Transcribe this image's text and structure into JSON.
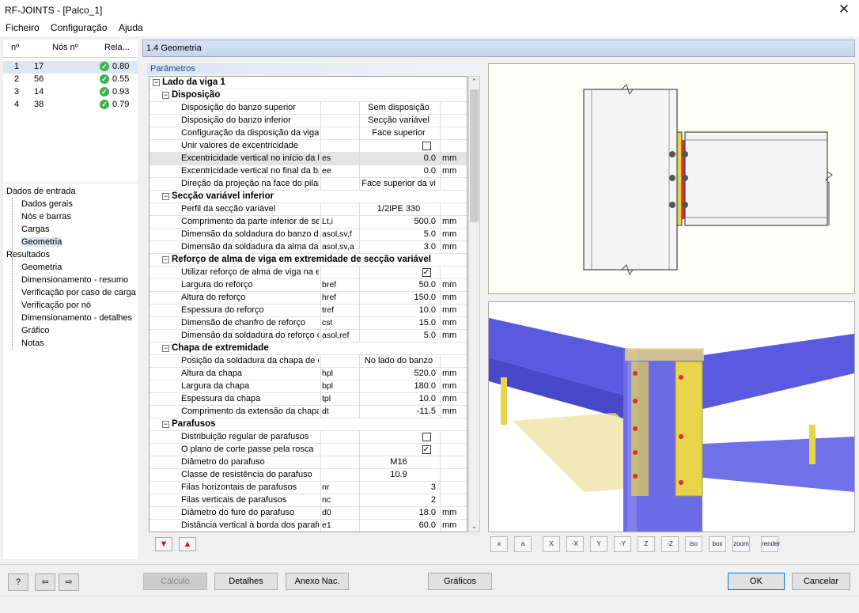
{
  "window": {
    "title": "RF-JOINTS - [Palco_1]",
    "close": "✕"
  },
  "menu": [
    "Ficheiro",
    "Configuração",
    "Ajuda"
  ],
  "nav": {
    "headers": [
      "nº",
      "Nós nº",
      "Rela..."
    ],
    "rows": [
      {
        "n": "1",
        "node": "17",
        "ratio": "0.80"
      },
      {
        "n": "2",
        "node": "56",
        "ratio": "0.55"
      },
      {
        "n": "3",
        "node": "14",
        "ratio": "0.93"
      },
      {
        "n": "4",
        "node": "38",
        "ratio": "0.79"
      }
    ]
  },
  "tree": {
    "input": "Dados de entrada",
    "input_items": [
      "Dados gerais",
      "Nós e barras",
      "Cargas",
      "Geometria"
    ],
    "results": "Resultados",
    "result_items": [
      "Geometria",
      "Dimensionamento - resumo",
      "Verificação por caso de carga",
      "Verificação por nó",
      "Dimensionamento - detalhes",
      "Gráfico",
      "Notas"
    ]
  },
  "section": "1.4 Geometria",
  "params_label": "Parâmetros",
  "grid": [
    {
      "lvl": 0,
      "hdr": true,
      "label": "Lado da viga 1"
    },
    {
      "lvl": 1,
      "hdr": true,
      "label": "Disposição"
    },
    {
      "lvl": 2,
      "label": "Disposição do banzo superior",
      "sym": "",
      "val": "Sem disposição",
      "unit": "",
      "c": true
    },
    {
      "lvl": 2,
      "label": "Disposição do banzo inferior",
      "sym": "",
      "val": "Secção variável",
      "unit": "",
      "c": true
    },
    {
      "lvl": 2,
      "label": "Configuração da disposição da viga",
      "sym": "",
      "val": "Face superior",
      "unit": "",
      "c": true
    },
    {
      "lvl": 2,
      "label": "Unir valores de excentricidade",
      "sym": "",
      "val": "",
      "unit": "",
      "cb": false
    },
    {
      "lvl": 2,
      "label": "Excentricidade vertical no início da b",
      "sym": "es",
      "val": "0.0",
      "unit": "mm",
      "hl": true
    },
    {
      "lvl": 2,
      "label": "Excentricidade vertical no final da ba",
      "sym": "ee",
      "val": "0.0",
      "unit": "mm"
    },
    {
      "lvl": 2,
      "label": "Direção da projeção na face do pilar",
      "sym": "",
      "val": "Face superior da vi",
      "unit": "",
      "c": true
    },
    {
      "lvl": 1,
      "hdr": true,
      "label": "Secção variável inferior"
    },
    {
      "lvl": 2,
      "label": "Perfil da secção variável",
      "sym": "",
      "val": "1/2IPE 330",
      "unit": "",
      "c": true
    },
    {
      "lvl": 2,
      "label": "Comprimento da parte inferior de sec",
      "sym": "Lt,i",
      "val": "500.0",
      "unit": "mm"
    },
    {
      "lvl": 2,
      "label": "Dimensão da soldadura do banzo da",
      "sym": "asol,sv,f",
      "val": "5.0",
      "unit": "mm"
    },
    {
      "lvl": 2,
      "label": "Dimensão da soldadura da alma da s",
      "sym": "asol,sv,a",
      "val": "3.0",
      "unit": "mm"
    },
    {
      "lvl": 1,
      "hdr": true,
      "label": "Reforço de alma de viga em extremidade de secção variável"
    },
    {
      "lvl": 2,
      "label": "Utilizar reforço de alma de viga na ex",
      "sym": "",
      "val": "",
      "unit": "",
      "cb": true
    },
    {
      "lvl": 2,
      "label": "Largura do reforço",
      "sym": "bref",
      "val": "50.0",
      "unit": "mm"
    },
    {
      "lvl": 2,
      "label": "Altura do reforço",
      "sym": "href",
      "val": "150.0",
      "unit": "mm"
    },
    {
      "lvl": 2,
      "label": "Espessura do reforço",
      "sym": "tref",
      "val": "10.0",
      "unit": "mm"
    },
    {
      "lvl": 2,
      "label": "Dimensão de chanfro de reforço",
      "sym": "cst",
      "val": "15.0",
      "unit": "mm"
    },
    {
      "lvl": 2,
      "label": "Dimensão da soldadura do reforço d",
      "sym": "asol,ref",
      "val": "5.0",
      "unit": "mm"
    },
    {
      "lvl": 1,
      "hdr": true,
      "label": "Chapa de extremidade"
    },
    {
      "lvl": 2,
      "label": "Posição da soldadura da chapa de e",
      "sym": "",
      "val": "No lado do banzo",
      "unit": "",
      "c": true
    },
    {
      "lvl": 2,
      "label": "Altura da chapa",
      "sym": "hpl",
      "val": "520.0",
      "unit": "mm"
    },
    {
      "lvl": 2,
      "label": "Largura da chapa",
      "sym": "bpl",
      "val": "180.0",
      "unit": "mm"
    },
    {
      "lvl": 2,
      "label": "Espessura da chapa",
      "sym": "tpl",
      "val": "10.0",
      "unit": "mm"
    },
    {
      "lvl": 2,
      "label": "Comprimento da extensão da chapa",
      "sym": "dt",
      "val": "-11.5",
      "unit": "mm"
    },
    {
      "lvl": 1,
      "hdr": true,
      "label": "Parafusos"
    },
    {
      "lvl": 2,
      "label": "Distribuição regular de parafusos",
      "sym": "",
      "val": "",
      "unit": "",
      "cb": false
    },
    {
      "lvl": 2,
      "label": "O plano de corte passe pela rosca",
      "sym": "",
      "val": "",
      "unit": "",
      "cb": true
    },
    {
      "lvl": 2,
      "label": "Diâmetro do parafuso",
      "sym": "",
      "val": "M16",
      "unit": "",
      "c": true
    },
    {
      "lvl": 2,
      "label": "Classe de resistência do parafuso",
      "sym": "",
      "val": "10.9",
      "unit": "",
      "c": true
    },
    {
      "lvl": 2,
      "label": "Filas horizontais de parafusos",
      "sym": "nr",
      "val": "3",
      "unit": ""
    },
    {
      "lvl": 2,
      "label": "Filas verticais de parafusos",
      "sym": "nc",
      "val": "2",
      "unit": ""
    },
    {
      "lvl": 2,
      "label": "Diâmetro do furo do parafuso",
      "sym": "d0",
      "val": "18.0",
      "unit": "mm"
    },
    {
      "lvl": 2,
      "label": "Distância vertical à borda dos parafu",
      "sym": "e1",
      "val": "60.0",
      "unit": "mm"
    }
  ],
  "view_tools": [
    "x",
    "a",
    "X",
    "-X",
    "Y",
    "-Y",
    "Z",
    "-Z",
    "iso",
    "box",
    "zoom",
    "render"
  ],
  "buttons": {
    "calc": "Cálculo",
    "details": "Detalhes",
    "annex": "Anexo Nac.",
    "graphics": "Gráficos",
    "ok": "OK",
    "cancel": "Cancelar"
  },
  "colors": {
    "check": "#3db34a",
    "beam3d": "#6e6ee8",
    "plate": "#e8d44a",
    "weld": "#d83030"
  }
}
